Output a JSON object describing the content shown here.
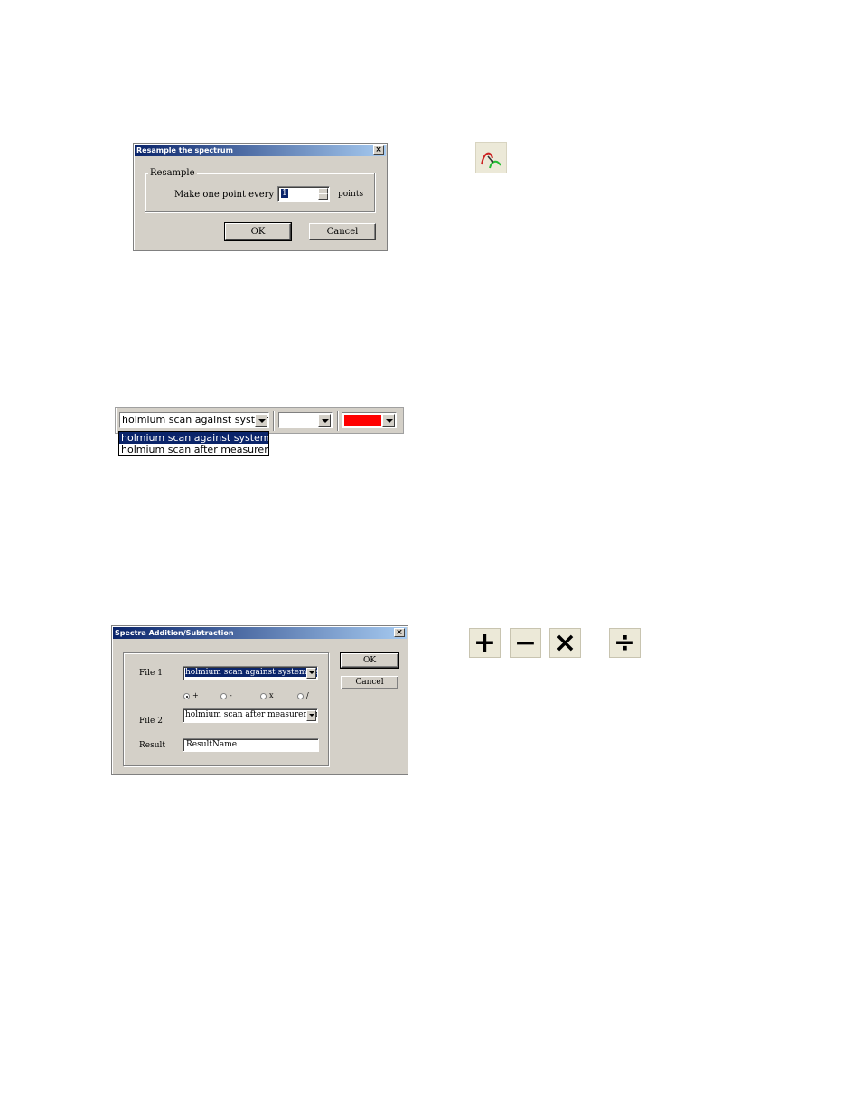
{
  "resample_dialog": {
    "title": "Resample the spectrum",
    "close_glyph": "×",
    "group_label": "Resample",
    "prompt_label": "Make one point every",
    "points_value": "1",
    "units_label": "points",
    "ok_label": "OK",
    "cancel_label": "Cancel"
  },
  "resample_icon": {
    "name": "resample-curve-icon",
    "colors": [
      "#cc2222",
      "#22bb33"
    ]
  },
  "toolbar": {
    "file_combo_value": "holmium scan against system",
    "second_combo_value": "",
    "color_combo_value": "#ff0000",
    "dropdown_items": [
      "holmium scan against system bas",
      "holmium scan after measurement"
    ]
  },
  "math_dialog": {
    "title": "Spectra Addition/Subtraction",
    "close_glyph": "×",
    "file1_label": "File 1",
    "file1_value": "holmium scan against system basel",
    "operators": [
      "+",
      "-",
      "x",
      "/"
    ],
    "selected_operator": "+",
    "file2_label": "File 2",
    "file2_value": "holmium scan after measurement b",
    "result_label": "Result",
    "result_value": "ResultName",
    "ok_label": "OK",
    "cancel_label": "Cancel"
  },
  "operator_icons": [
    {
      "name": "plus-icon",
      "glyph": "+"
    },
    {
      "name": "minus-icon",
      "glyph": "−"
    },
    {
      "name": "multiply-icon",
      "glyph": "×"
    },
    {
      "name": "divide-icon",
      "glyph": "÷"
    }
  ]
}
